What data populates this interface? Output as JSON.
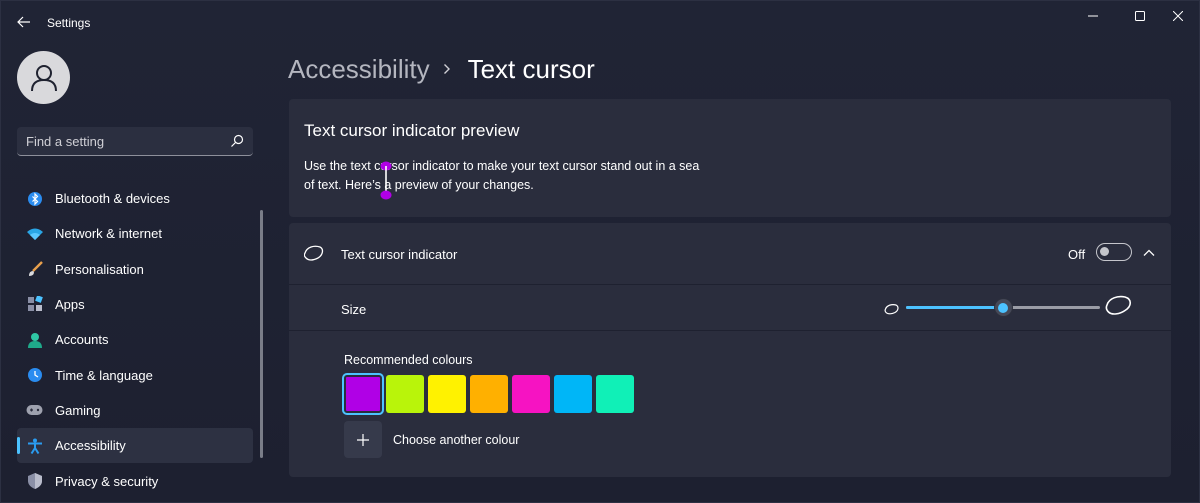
{
  "titlebar": {
    "app_title": "Settings",
    "back_icon": "arrow-left-icon",
    "controls": [
      "minimize-icon",
      "maximize-icon",
      "close-icon"
    ]
  },
  "sidebar": {
    "search_placeholder": "Find a setting",
    "items": [
      {
        "label": "Bluetooth & devices",
        "icon": "bluetooth-icon"
      },
      {
        "label": "Network & internet",
        "icon": "wifi-icon"
      },
      {
        "label": "Personalisation",
        "icon": "brush-icon"
      },
      {
        "label": "Apps",
        "icon": "apps-icon"
      },
      {
        "label": "Accounts",
        "icon": "person-icon"
      },
      {
        "label": "Time & language",
        "icon": "globe-clock-icon"
      },
      {
        "label": "Gaming",
        "icon": "gamepad-icon"
      },
      {
        "label": "Accessibility",
        "icon": "accessibility-icon",
        "active": true
      },
      {
        "label": "Privacy & security",
        "icon": "shield-icon"
      }
    ]
  },
  "breadcrumb": {
    "parent": "Accessibility",
    "current": "Text cursor"
  },
  "preview": {
    "title": "Text cursor indicator preview",
    "description": "Use the text cursor indicator to make your text cursor stand out in a sea of text. Here’s a preview of your changes.",
    "indicator_color": "#b000e6"
  },
  "indicator": {
    "label": "Text cursor indicator",
    "toggle_state": "Off",
    "expanded": true,
    "size": {
      "label": "Size",
      "value_fraction": 0.5
    },
    "colours": {
      "label": "Recommended colours",
      "swatches": [
        {
          "color": "#b000e6",
          "selected": true
        },
        {
          "color": "#b9f40a",
          "selected": false
        },
        {
          "color": "#fff200",
          "selected": false
        },
        {
          "color": "#ffb000",
          "selected": false
        },
        {
          "color": "#f613c2",
          "selected": false
        },
        {
          "color": "#00b6f7",
          "selected": false
        },
        {
          "color": "#10f0b7",
          "selected": false
        }
      ],
      "add_label": "Choose another colour"
    }
  },
  "accent_color": "#4cc2ff"
}
